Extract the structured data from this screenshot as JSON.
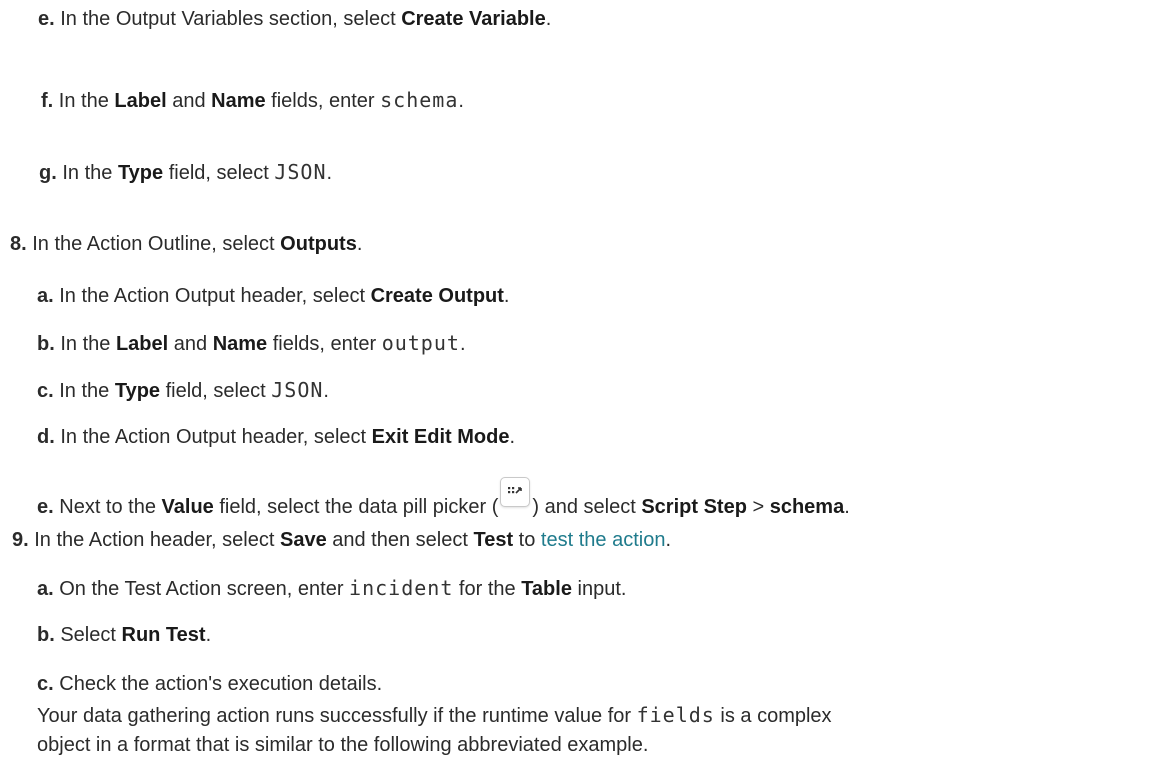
{
  "steps": {
    "s7e": {
      "num": "e.",
      "t1": "In the Output Variables section, select ",
      "b1": "Create Variable",
      "t2": "."
    },
    "s7f": {
      "num": "f.",
      "t1": "In the ",
      "b1": "Label",
      "t2": " and ",
      "b2": "Name",
      "t3": " fields, enter ",
      "c1": "schema",
      "t4": "."
    },
    "s7g": {
      "num": "g.",
      "t1": "In the ",
      "b1": "Type",
      "t2": " field, select ",
      "c1": "JSON",
      "t3": "."
    },
    "s8": {
      "num": "8.",
      "t1": "In the Action Outline, select ",
      "b1": "Outputs",
      "t2": "."
    },
    "s8a": {
      "num": "a.",
      "t1": "In the Action Output header, select ",
      "b1": "Create Output",
      "t2": "."
    },
    "s8b": {
      "num": "b.",
      "t1": "In the ",
      "b1": "Label",
      "t2": " and ",
      "b2": "Name",
      "t3": " fields, enter ",
      "c1": "output",
      "t4": "."
    },
    "s8c": {
      "num": "c.",
      "t1": "In the ",
      "b1": "Type",
      "t2": " field, select ",
      "c1": "JSON",
      "t3": "."
    },
    "s8d": {
      "num": "d.",
      "t1": "In the Action Output header, select ",
      "b1": "Exit Edit Mode",
      "t2": "."
    },
    "s8e": {
      "num": "e.",
      "t1": "Next to the ",
      "b1": "Value",
      "t2": " field, select the data pill picker (",
      "icon": "data-pill-picker-icon",
      "t3": ") and select ",
      "b2": "Script Step",
      "t4": " > ",
      "b3": "schema",
      "t5": "."
    },
    "s9": {
      "num": "9.",
      "t1": "In the Action header, select ",
      "b1": "Save",
      "t2": " and then select ",
      "b2": "Test",
      "t3": " to ",
      "link": "test the action",
      "t4": "."
    },
    "s9a": {
      "num": "a.",
      "t1": "On the Test Action screen, enter ",
      "c1": "incident",
      "t2": " for the ",
      "b1": "Table",
      "t3": " input."
    },
    "s9b": {
      "num": "b.",
      "t1": "Select ",
      "b1": "Run Test",
      "t2": "."
    },
    "s9c": {
      "num": "c.",
      "t1": "Check the action's execution details.",
      "p1": "Your data gathering action runs successfully if the runtime value for ",
      "c1": "fields",
      "p2": " is a complex",
      "p3": "object in a format that is similar to the following abbreviated example."
    }
  },
  "colors": {
    "text": "#2b2b2b",
    "link": "#1f7b8c"
  }
}
